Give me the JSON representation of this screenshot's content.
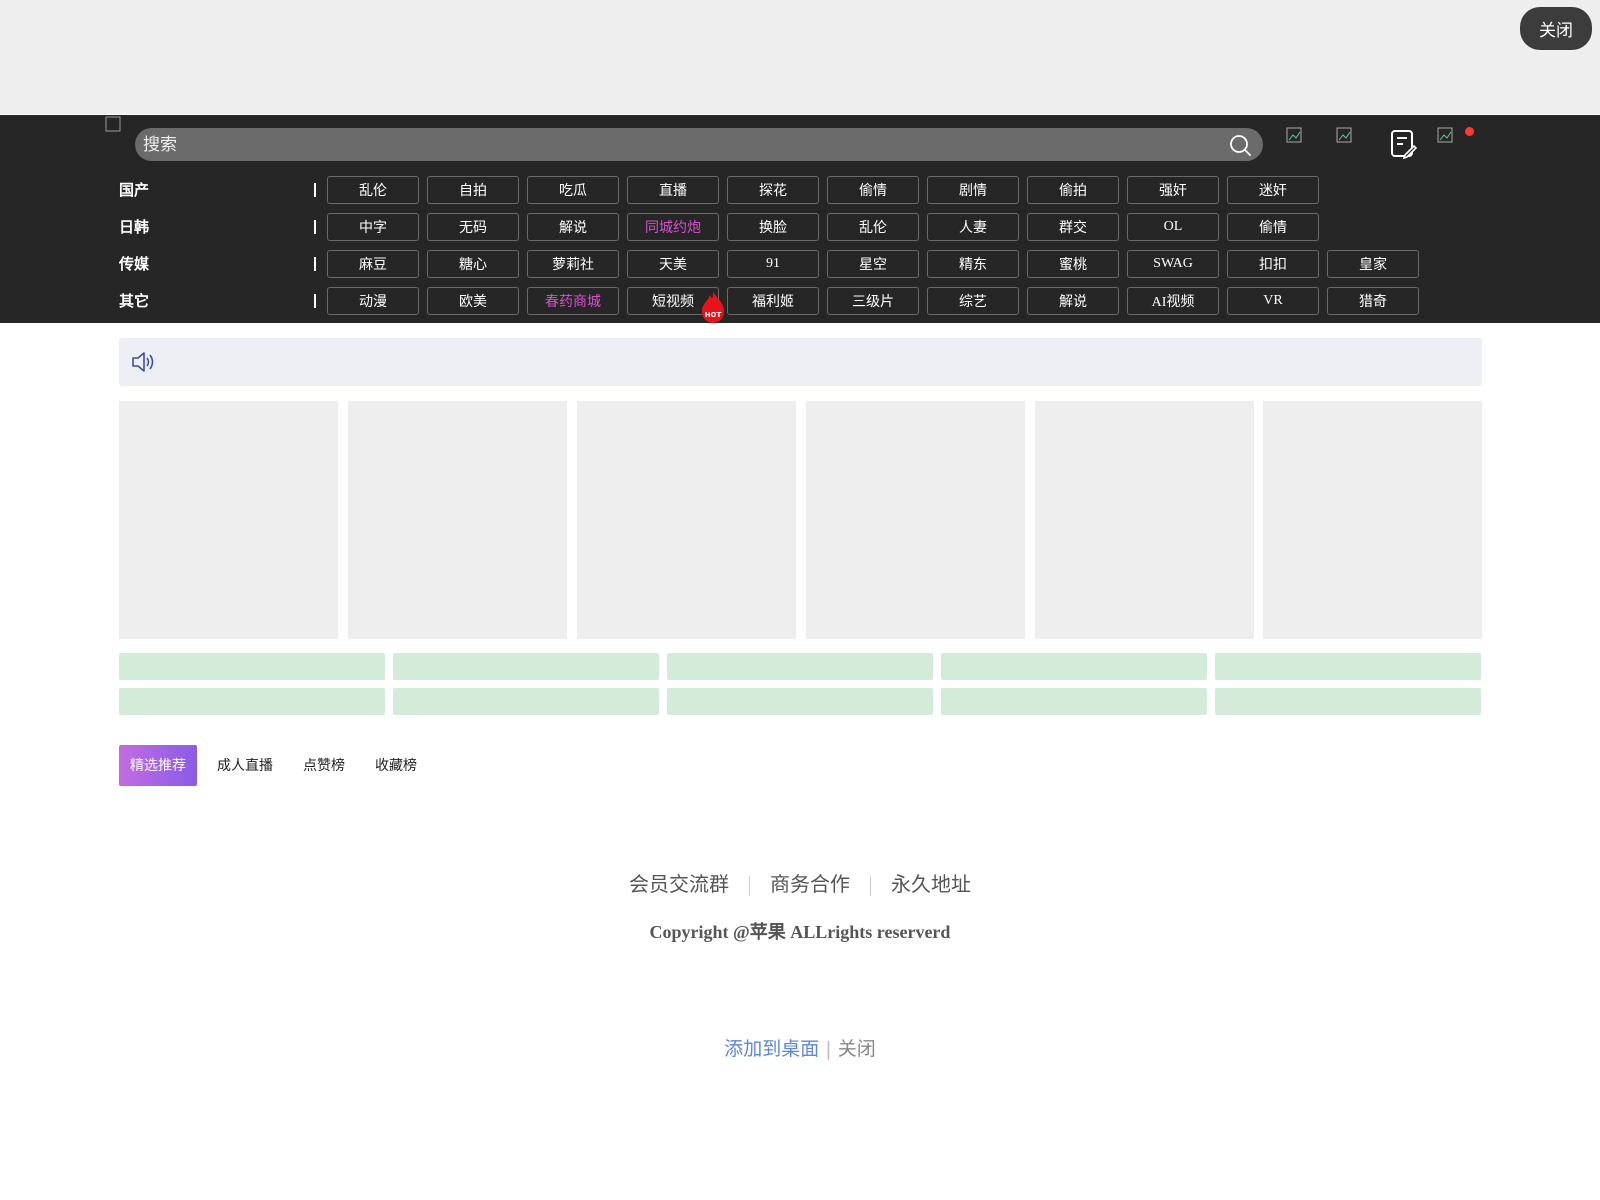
{
  "top_bar": {
    "close_label": "关闭"
  },
  "header": {
    "search_placeholder": "搜索"
  },
  "category_rows": [
    {
      "label": "国产",
      "tags": [
        {
          "text": "乱伦"
        },
        {
          "text": "自拍"
        },
        {
          "text": "吃瓜"
        },
        {
          "text": "直播"
        },
        {
          "text": "探花"
        },
        {
          "text": "偷情"
        },
        {
          "text": "剧情"
        },
        {
          "text": "偷拍"
        },
        {
          "text": "强奸"
        },
        {
          "text": "迷奸"
        }
      ]
    },
    {
      "label": "日韩",
      "tags": [
        {
          "text": "中字"
        },
        {
          "text": "无码"
        },
        {
          "text": "解说"
        },
        {
          "text": "同城约炮",
          "highlight": true
        },
        {
          "text": "换脸"
        },
        {
          "text": "乱伦"
        },
        {
          "text": "人妻"
        },
        {
          "text": "群交"
        },
        {
          "text": "OL"
        },
        {
          "text": "偷情"
        }
      ]
    },
    {
      "label": "传媒",
      "tags": [
        {
          "text": "麻豆"
        },
        {
          "text": "糖心"
        },
        {
          "text": "萝莉社"
        },
        {
          "text": "天美"
        },
        {
          "text": "91"
        },
        {
          "text": "星空"
        },
        {
          "text": "精东"
        },
        {
          "text": "蜜桃"
        },
        {
          "text": "SWAG"
        },
        {
          "text": "扣扣"
        },
        {
          "text": "皇家"
        }
      ]
    },
    {
      "label": "其它",
      "tags": [
        {
          "text": "动漫"
        },
        {
          "text": "欧美"
        },
        {
          "text": "春药商城",
          "highlight": true
        },
        {
          "text": "短视频"
        },
        {
          "text": "福利姬"
        },
        {
          "text": "三级片"
        },
        {
          "text": "综艺"
        },
        {
          "text": "解说"
        },
        {
          "text": "AI视频"
        },
        {
          "text": "VR"
        },
        {
          "text": "猎奇"
        }
      ]
    }
  ],
  "hot_badge_text": "HOT",
  "tabs": [
    {
      "label": "精选推荐",
      "active": true
    },
    {
      "label": "成人直播"
    },
    {
      "label": "点赞榜"
    },
    {
      "label": "收藏榜"
    }
  ],
  "footer": {
    "link1": "会员交流群",
    "link2": "商务合作",
    "link3": "永久地址",
    "copyright": "Copyright @苹果 ALLrights reserverd"
  },
  "add_to_desktop": {
    "add_label": "添加到桌面",
    "close_label": "关闭"
  },
  "colors": {
    "header_bg": "#262626",
    "highlight_tag": "#d94fcf",
    "tab_gradient_start": "#c26de0",
    "tab_gradient_end": "#8a5ce6"
  }
}
